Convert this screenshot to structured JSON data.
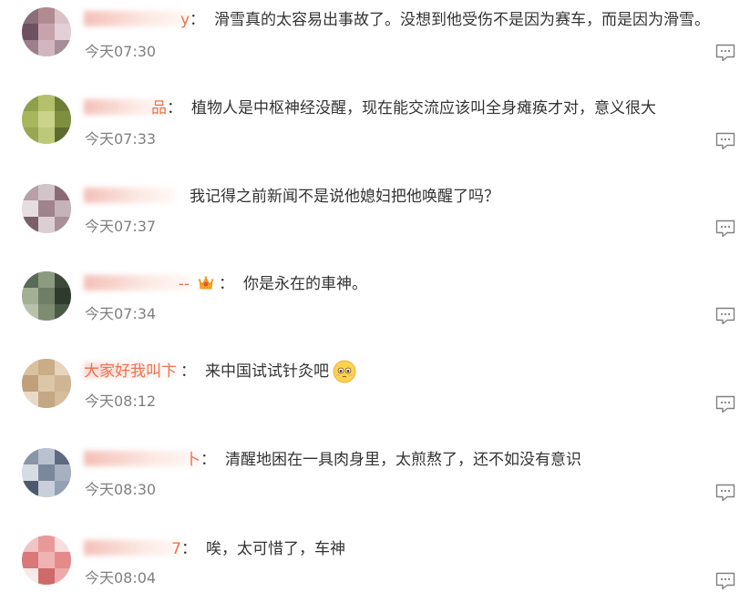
{
  "comments": [
    {
      "nick_tail": "y",
      "text": "滑雪真的太容易出事故了。没想到他受伤不是因为赛车，而是因为滑雪。",
      "time": "今天07:30",
      "avatar_colors": [
        "#8a6f7a",
        "#b08b94",
        "#d8c2c8",
        "#6d5160",
        "#c7a3ae",
        "#e2d0d6",
        "#9d7f8b",
        "#d1b5bf",
        "#a78d98"
      ]
    },
    {
      "nick_tail": "品",
      "text": "植物人是中枢神经没醒，现在能交流应该叫全身瘫痪才对，意义很大",
      "time": "今天07:33",
      "avatar_colors": [
        "#8ea04a",
        "#b4c06a",
        "#6e7e36",
        "#a7b65c",
        "#c9d48a",
        "#7f8f3f",
        "#98a852",
        "#bdc97a",
        "#5e6b2e"
      ]
    },
    {
      "nick_tail": "",
      "text": "我记得之前新闻不是说他媳妇把他唤醒了吗？",
      "time": "今天07:37",
      "avatar_colors": [
        "#b7a0a8",
        "#d2c3c8",
        "#8a6b74",
        "#e6dde0",
        "#9f848d",
        "#c6b2b9",
        "#7b5f68",
        "#dccfd3",
        "#a89099"
      ]
    },
    {
      "nick_tail": "--",
      "text": "你是永在的車神。",
      "time": "今天07:34",
      "avatar_colors": [
        "#5a6b55",
        "#8c9b7f",
        "#3d4a3b",
        "#a3b095",
        "#6f7e65",
        "#2f3a2f",
        "#b8c2ab",
        "#7e8c72",
        "#4b5a47"
      ]
    },
    {
      "nick_tail": "大家好我叫卞",
      "text": "来中国试试针灸吧",
      "time": "今天08:12",
      "avatar_colors": [
        "#d8c0a0",
        "#c9ad88",
        "#e6d4bc",
        "#bfa07a",
        "#dcc6a8",
        "#cfb594",
        "#e9dac6",
        "#c4a784",
        "#d6bd9c"
      ]
    },
    {
      "nick_tail": "卜",
      "text": "清醒地困在一具肉身里，太煎熬了，还不如没有意识",
      "time": "今天08:30",
      "avatar_colors": [
        "#8a95a8",
        "#b9c1cf",
        "#5d6a80",
        "#d7dce4",
        "#7b879b",
        "#a6b0c0",
        "#4c596e",
        "#c8cfda",
        "#94a0b3"
      ]
    },
    {
      "nick_tail": "7",
      "text": "唉，太可惜了，车神",
      "time": "今天08:04",
      "avatar_colors": [
        "#f2c4c4",
        "#e89a9a",
        "#f7dede",
        "#d97878",
        "#f0b3b3",
        "#e48a8a",
        "#fae9e9",
        "#cf6a6a",
        "#eeaaaa"
      ]
    }
  ]
}
